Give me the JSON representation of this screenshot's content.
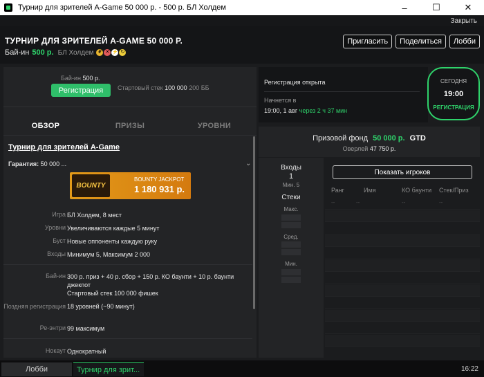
{
  "window": {
    "title": "Турнир для зрителей A-Game 50 000 р. - 500 р. БЛ Холдем",
    "close_label": "Закрыть",
    "minimize": "–",
    "maximize": "☐",
    "close": "✕"
  },
  "header": {
    "title": "ТУРНИР ДЛЯ ЗРИТЕЛЕЙ A-GAME 50 000 Р.",
    "buyin_label": "Бай-ин",
    "buyin_value": "500 р.",
    "game": "БЛ Холдем",
    "buttons": {
      "invite": "Пригласить",
      "share": "Поделиться",
      "lobby": "Лобби"
    }
  },
  "registration": {
    "buyin_label": "Бай-ин",
    "buyin_value": "500 р.",
    "button": "Регистрация",
    "stack_label": "Стартовый стек",
    "stack_value": "100 000",
    "stack_bb": "200 ББ"
  },
  "tabs": [
    "ОБЗОР",
    "ПРИЗЫ",
    "УРОВНИ"
  ],
  "overview": {
    "title": "Турнир для зрителей A-Game",
    "guarantee_label": "Гарантия:",
    "guarantee_value": "50 000 ...",
    "jackpot_logo": "BOUNTY",
    "jackpot_label": "BOUNTY JACKPOT",
    "jackpot_value": "1 180 931 р.",
    "rows": [
      {
        "k": "Игра",
        "v": "БЛ Холдем, 8 мест"
      },
      {
        "k": "Уровни",
        "v": "Увеличиваются каждые 5 минут"
      },
      {
        "k": "Буст",
        "v": "Новые оппоненты каждую руку"
      },
      {
        "k": "Входы",
        "v": "Минимум 5, Максимум 2 000"
      },
      {
        "k": "Бай-ин",
        "v": "300 р. приз + 40 р. сбор + 150 р. КО баунти + 10 р. баунти джекпот",
        "v2": "Стартовый стек 100 000 фишек"
      },
      {
        "k": "Поздняя регистрация",
        "v": "18 уровней (~90 минут)"
      },
      {
        "k": "Ре-энтри",
        "v": "99 максимум"
      },
      {
        "k": "Нокаут",
        "v": "Однократный"
      }
    ]
  },
  "status": {
    "open": "Регистрация открыта",
    "starts_label": "Начнется в",
    "starts_value": "19:00, 1 авг",
    "countdown": "через 2 ч 37 мин"
  },
  "today": {
    "label": "СЕГОДНЯ",
    "time": "19:00",
    "state": "РЕГИСТРАЦИЯ"
  },
  "prize": {
    "label": "Призовой фонд",
    "amount": "50 000 р.",
    "gtd": "GTD",
    "overlay_label": "Оверлей",
    "overlay_value": "47 750 р."
  },
  "entries": {
    "label": "Входы",
    "value": "1",
    "min": "Мин. 5",
    "stacks_label": "Стеки",
    "max_label": "Макс.",
    "avg_label": "Сред.",
    "min_label": "Мин."
  },
  "players": {
    "show_button": "Показать игроков",
    "columns": [
      "Ранг",
      "Имя",
      "КО баунти",
      "Стек/Приз"
    ],
    "placeholder": "--"
  },
  "taskbar": {
    "lobby": "Лобби",
    "tournament": "Турнир для зрит...",
    "clock": "16:22"
  },
  "colors": {
    "accent_green": "#2fd36b",
    "background": "#1b1c1e",
    "jackpot": "#e39a19"
  }
}
